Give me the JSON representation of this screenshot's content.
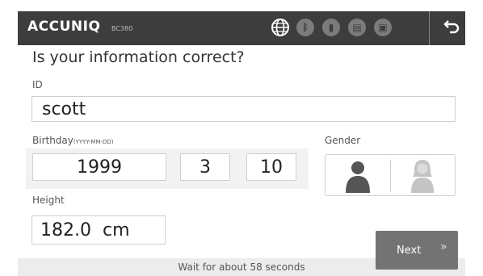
{
  "header": {
    "brand": "ACCUNIQ",
    "model": "BC380",
    "icons": [
      "globe-icon",
      "bluetooth-icon",
      "memory-card-icon",
      "id-card-icon",
      "printer-icon",
      "back-icon"
    ]
  },
  "title": "Is your information correct?",
  "id_field": {
    "label": "ID",
    "value": "scott"
  },
  "birthday": {
    "label": "Birthday",
    "format": "(YYYY-MM-DD)",
    "year": "1999",
    "month": "3",
    "day": "10"
  },
  "gender": {
    "label": "Gender",
    "options": [
      "male",
      "female"
    ],
    "selected": "male"
  },
  "height": {
    "label": "Height",
    "value": "182.0",
    "unit": "cm"
  },
  "footer": {
    "prefix": "Wait for about ",
    "seconds": "58",
    "suffix": " seconds"
  },
  "next_button": {
    "label": "Next",
    "icon": "»"
  },
  "colors": {
    "topbar": "#3d3d3d",
    "button": "#737373",
    "selected_gender": "#555555",
    "unselected_gender": "#c4c4c4"
  }
}
